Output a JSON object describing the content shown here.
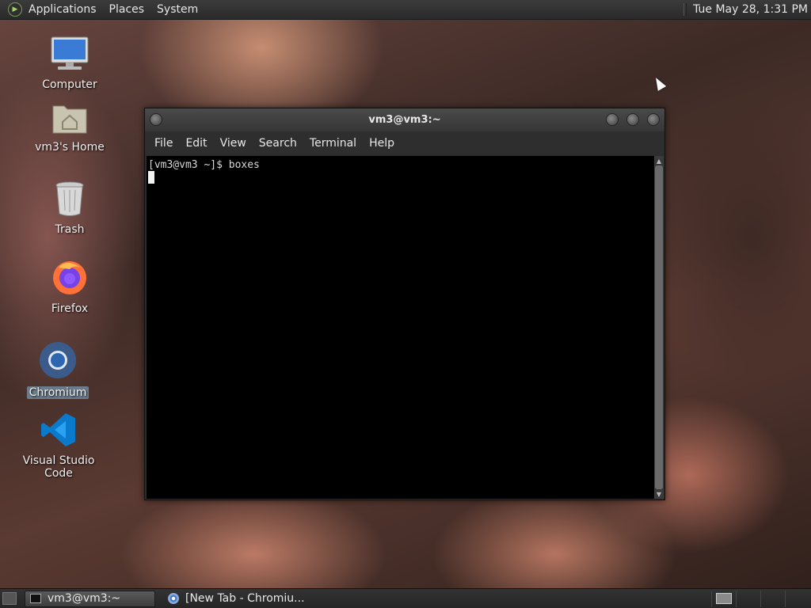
{
  "top_panel": {
    "menus": [
      "Applications",
      "Places",
      "System"
    ],
    "clock": "Tue May 28,  1:31 PM"
  },
  "desktop": {
    "icons": [
      {
        "label": "Computer",
        "icon": "computer-icon"
      },
      {
        "label": "vm3's Home",
        "icon": "home-folder-icon"
      },
      {
        "label": "Trash",
        "icon": "trash-icon"
      },
      {
        "label": "Firefox",
        "icon": "firefox-icon"
      },
      {
        "label": "Chromium",
        "icon": "chromium-icon",
        "selected": true
      },
      {
        "label": "Visual Studio Code",
        "icon": "vscode-icon"
      }
    ]
  },
  "terminal": {
    "title": "vm3@vm3:~",
    "menu": [
      "File",
      "Edit",
      "View",
      "Search",
      "Terminal",
      "Help"
    ],
    "lines": [
      "[vm3@vm3 ~]$ boxes"
    ]
  },
  "taskbar": {
    "tasks": [
      {
        "label": "vm3@vm3:~",
        "active": true
      },
      {
        "label": "[New Tab - Chromiu...",
        "active": false
      }
    ]
  },
  "colors": {
    "panel_bg": "#2e2e2e",
    "terminal_bg": "#000000",
    "selection": "#6b7c8c"
  }
}
